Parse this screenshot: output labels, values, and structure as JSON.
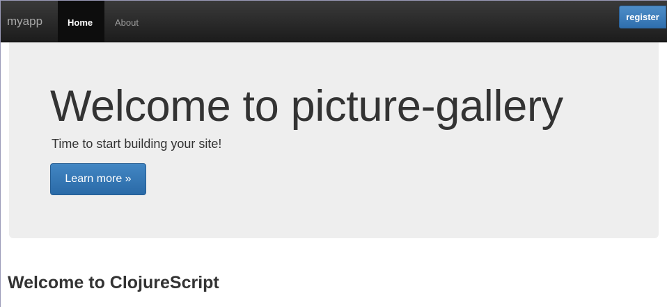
{
  "navbar": {
    "brand": "myapp",
    "items": [
      {
        "label": "Home",
        "active": true
      },
      {
        "label": "About",
        "active": false
      }
    ],
    "register_label": "register"
  },
  "jumbotron": {
    "title": "Welcome to picture-gallery",
    "subtitle": "Time to start building your site!",
    "button_label": "Learn more »"
  },
  "content": {
    "heading": "Welcome to ClojureScript"
  },
  "colors": {
    "navbar_bg": "#222222",
    "jumbotron_bg": "#eeeeee",
    "primary_button": "#337ab7",
    "text": "#333333"
  }
}
